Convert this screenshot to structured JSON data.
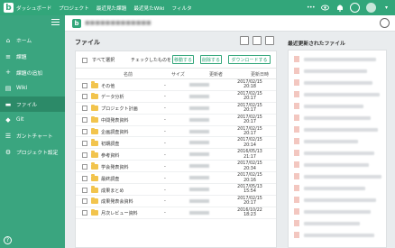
{
  "topbar": {
    "logo": "b",
    "nav": [
      "ダッシュボード",
      "プロジェクト",
      "最近見た課題",
      "最近見たWiki",
      "フィルタ"
    ],
    "more": "•••",
    "caret": "▾"
  },
  "sidebar": {
    "items": [
      {
        "label": "ホーム",
        "icon": "home-icon",
        "glyph": "⌂"
      },
      {
        "label": "課題",
        "icon": "list-icon",
        "glyph": "≡"
      },
      {
        "label": "課題の追加",
        "icon": "plus-icon",
        "glyph": "+"
      },
      {
        "label": "Wiki",
        "icon": "wiki-icon",
        "glyph": "▤"
      },
      {
        "label": "ファイル",
        "icon": "folder-icon",
        "glyph": "▬"
      },
      {
        "label": "Git",
        "icon": "git-icon",
        "glyph": "◆"
      },
      {
        "label": "ガントチャート",
        "icon": "gantt-icon",
        "glyph": "☰"
      },
      {
        "label": "プロジェクト設定",
        "icon": "gear-icon",
        "glyph": "⚙"
      }
    ],
    "help": "?"
  },
  "project": {
    "logo": "b",
    "name": "■■■■■■■■■■■■■"
  },
  "files": {
    "title": "ファイル",
    "select_all": "すべて選択",
    "checked_label": "チェックしたものを",
    "move": "移動する",
    "delete": "削除する",
    "download": "ダウンロードする",
    "headers": {
      "name": "名前",
      "size": "サイズ",
      "owner": "更新者",
      "date": "更新日時"
    },
    "rows": [
      {
        "name": "その他",
        "size": "-",
        "date": "2017/02/15",
        "time": "20:18"
      },
      {
        "name": "データ分析",
        "size": "-",
        "date": "2017/02/15",
        "time": "20:17"
      },
      {
        "name": "プロジェクト計画",
        "size": "-",
        "date": "2017/02/15",
        "time": "20:17"
      },
      {
        "name": "中間発表資料",
        "size": "-",
        "date": "2017/02/15",
        "time": "20:17"
      },
      {
        "name": "企画調査資料",
        "size": "-",
        "date": "2017/02/15",
        "time": "20:17"
      },
      {
        "name": "初期調査",
        "size": "-",
        "date": "2017/02/15",
        "time": "20:14"
      },
      {
        "name": "参考資料",
        "size": "-",
        "date": "2016/05/13",
        "time": "21:17"
      },
      {
        "name": "学会発表資料",
        "size": "-",
        "date": "2017/02/15",
        "time": "20:34"
      },
      {
        "name": "最終調査",
        "size": "-",
        "date": "2017/02/15",
        "time": "20:16"
      },
      {
        "name": "成果まとめ",
        "size": "-",
        "date": "2017/05/13",
        "time": "15:54"
      },
      {
        "name": "成果発表会資料",
        "size": "-",
        "date": "2017/02/15",
        "time": "20:17"
      },
      {
        "name": "月次レビュー資料",
        "size": "-",
        "date": "2016/10/22",
        "time": "18:23"
      }
    ]
  },
  "recent": {
    "title": "最近更新されたファイル"
  }
}
